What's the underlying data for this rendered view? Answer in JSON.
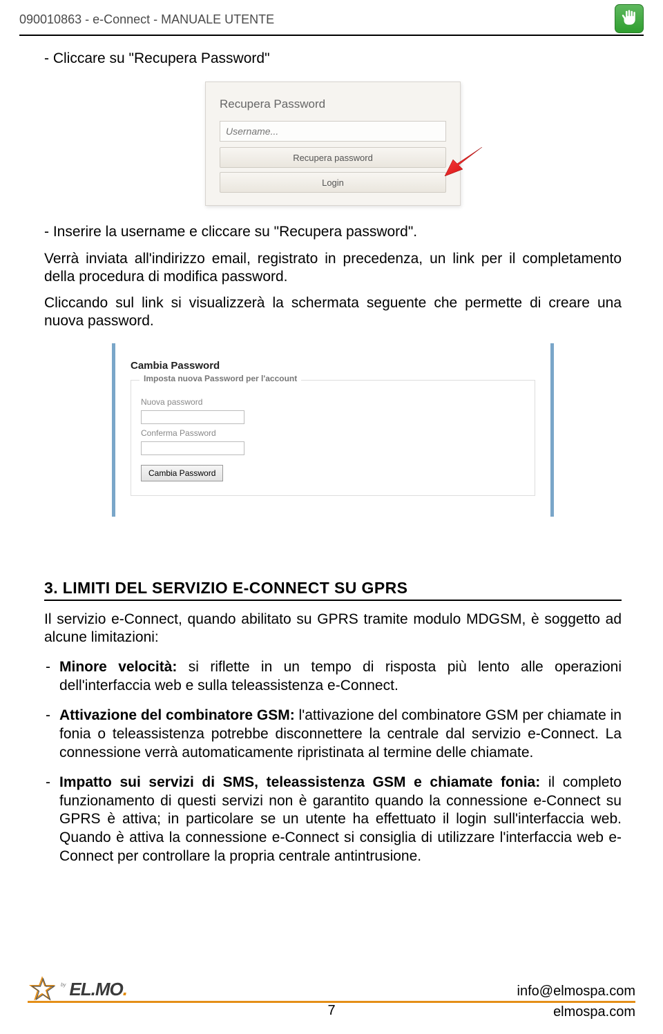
{
  "header": {
    "title": "090010863 - e-Connect - MANUALE UTENTE"
  },
  "instr1": "- Cliccare su \"Recupera Password\"",
  "shot1": {
    "title": "Recupera Password",
    "placeholder": "Username...",
    "btn_recupera": "Recupera password",
    "btn_login": "Login"
  },
  "instr2": "- Inserire la username e cliccare su \"Recupera password\".",
  "instr3": "Verrà inviata all'indirizzo email, registrato in precedenza, un link per il completamento della procedura di modifica password.",
  "instr4": "Cliccando sul link si visualizzerà la schermata seguente che permette di creare una nuova password.",
  "shot2": {
    "title": "Cambia Password",
    "legend": "Imposta nuova Password per l'account",
    "label1": "Nuova password",
    "label2": "Conferma Password",
    "submit": "Cambia Password"
  },
  "section": {
    "heading": "3. LIMITI DEL SERVIZIO E-CONNECT SU GPRS",
    "intro": "Il servizio e-Connect, quando abilitato su GPRS tramite modulo MDGSM, è soggetto ad alcune limitazioni:",
    "b1_bold": "Minore velocità:",
    "b1_text": " si riflette in un tempo di risposta più lento alle operazioni dell'interfaccia web e sulla teleassistenza e-Connect.",
    "b2_bold": "Attivazione del combinatore GSM:",
    "b2_text": " l'attivazione del combinatore GSM per chiamate in fonia o teleassistenza potrebbe disconnettere la centrale dal servizio e-Connect. La connessione verrà automaticamente ripristinata al termine delle chiamate.",
    "b3_bold": "Impatto sui servizi di SMS, teleassistenza GSM e chiamate fonia:",
    "b3_text": " il completo funzionamento di questi servizi non è garantito quando la connessione e-Connect su GPRS è attiva; in particolare se un utente ha effettuato il login sull'interfaccia web. Quando è attiva la connessione e-Connect si consiglia di utilizzare l'interfaccia web e-Connect per controllare la propria centrale antintrusione."
  },
  "footer": {
    "page": "7",
    "email": "info@elmospa.com",
    "site": "elmospa.com"
  }
}
